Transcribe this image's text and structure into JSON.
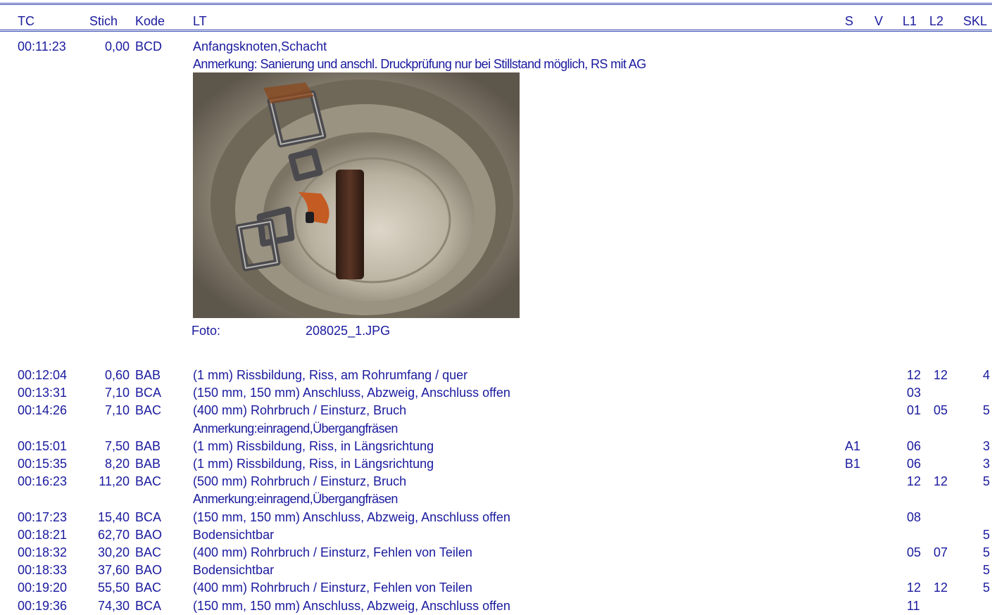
{
  "columns": {
    "tc": "TC",
    "stich": "Stich",
    "kode": "Kode",
    "lt": "LT",
    "s": "S",
    "v": "V",
    "l1": "L1",
    "l2": "L2",
    "skl": "SKL"
  },
  "first_entry": {
    "tc": "00:11:23",
    "stich": "0,00",
    "kode": "BCD",
    "lt": "Anfangsknoten,Schacht",
    "remark": "Anmerkung: Sanierung und anschl. Druckprüfung nur bei Stillstand möglich, RS mit AG",
    "photo_label": "Foto:",
    "photo_file": "208025_1.JPG"
  },
  "rows": [
    {
      "tc": "00:12:04",
      "stich": "0,60",
      "kode": "BAB",
      "lt": "(1 mm) Rissbildung, Riss, am Rohrumfang / quer",
      "s": "",
      "v": "",
      "l1": "12",
      "l2": "12",
      "skl": "4"
    },
    {
      "tc": "00:13:31",
      "stich": "7,10",
      "kode": "BCA",
      "lt": "(150 mm, 150 mm) Anschluss, Abzweig, Anschluss offen",
      "s": "",
      "v": "",
      "l1": "03",
      "l2": "",
      "skl": ""
    },
    {
      "tc": "00:14:26",
      "stich": "7,10",
      "kode": "BAC",
      "lt": "(400 mm) Rohrbruch / Einsturz, Bruch",
      "s": "",
      "v": "",
      "l1": "01",
      "l2": "05",
      "skl": "5"
    },
    {
      "tc": "",
      "stich": "",
      "kode": "",
      "lt": "Anmerkung:einragend,Übergangfräsen",
      "s": "",
      "v": "",
      "l1": "",
      "l2": "",
      "skl": ""
    },
    {
      "tc": "00:15:01",
      "stich": "7,50",
      "kode": "BAB",
      "lt": "(1 mm) Rissbildung, Riss, in Längsrichtung",
      "s": "A1",
      "v": "",
      "l1": "06",
      "l2": "",
      "skl": "3"
    },
    {
      "tc": "00:15:35",
      "stich": "8,20",
      "kode": "BAB",
      "lt": "(1 mm) Rissbildung, Riss, in Längsrichtung",
      "s": "B1",
      "v": "",
      "l1": "06",
      "l2": "",
      "skl": "3"
    },
    {
      "tc": "00:16:23",
      "stich": "11,20",
      "kode": "BAC",
      "lt": "(500 mm) Rohrbruch / Einsturz, Bruch",
      "s": "",
      "v": "",
      "l1": "12",
      "l2": "12",
      "skl": "5"
    },
    {
      "tc": "",
      "stich": "",
      "kode": "",
      "lt": "Anmerkung:einragend,Übergangfräsen",
      "s": "",
      "v": "",
      "l1": "",
      "l2": "",
      "skl": ""
    },
    {
      "tc": "00:17:23",
      "stich": "15,40",
      "kode": "BCA",
      "lt": "(150 mm, 150 mm) Anschluss, Abzweig, Anschluss offen",
      "s": "",
      "v": "",
      "l1": "08",
      "l2": "",
      "skl": ""
    },
    {
      "tc": "00:18:21",
      "stich": "62,70",
      "kode": "BAO",
      "lt": "Bodensichtbar",
      "s": "",
      "v": "",
      "l1": "",
      "l2": "",
      "skl": "5"
    },
    {
      "tc": "00:18:32",
      "stich": "30,20",
      "kode": "BAC",
      "lt": "(400 mm) Rohrbruch / Einsturz, Fehlen von Teilen",
      "s": "",
      "v": "",
      "l1": "05",
      "l2": "07",
      "skl": "5"
    },
    {
      "tc": "00:18:33",
      "stich": "37,60",
      "kode": "BAO",
      "lt": "Bodensichtbar",
      "s": "",
      "v": "",
      "l1": "",
      "l2": "",
      "skl": "5"
    },
    {
      "tc": "00:19:20",
      "stich": "55,50",
      "kode": "BAC",
      "lt": "(400 mm) Rohrbruch / Einsturz, Fehlen von Teilen",
      "s": "",
      "v": "",
      "l1": "12",
      "l2": "12",
      "skl": "5"
    },
    {
      "tc": "00:19:36",
      "stich": "74,30",
      "kode": "BCA",
      "lt": "(150 mm, 150 mm) Anschluss, Abzweig, Anschluss offen",
      "s": "",
      "v": "",
      "l1": "11",
      "l2": "",
      "skl": ""
    }
  ]
}
